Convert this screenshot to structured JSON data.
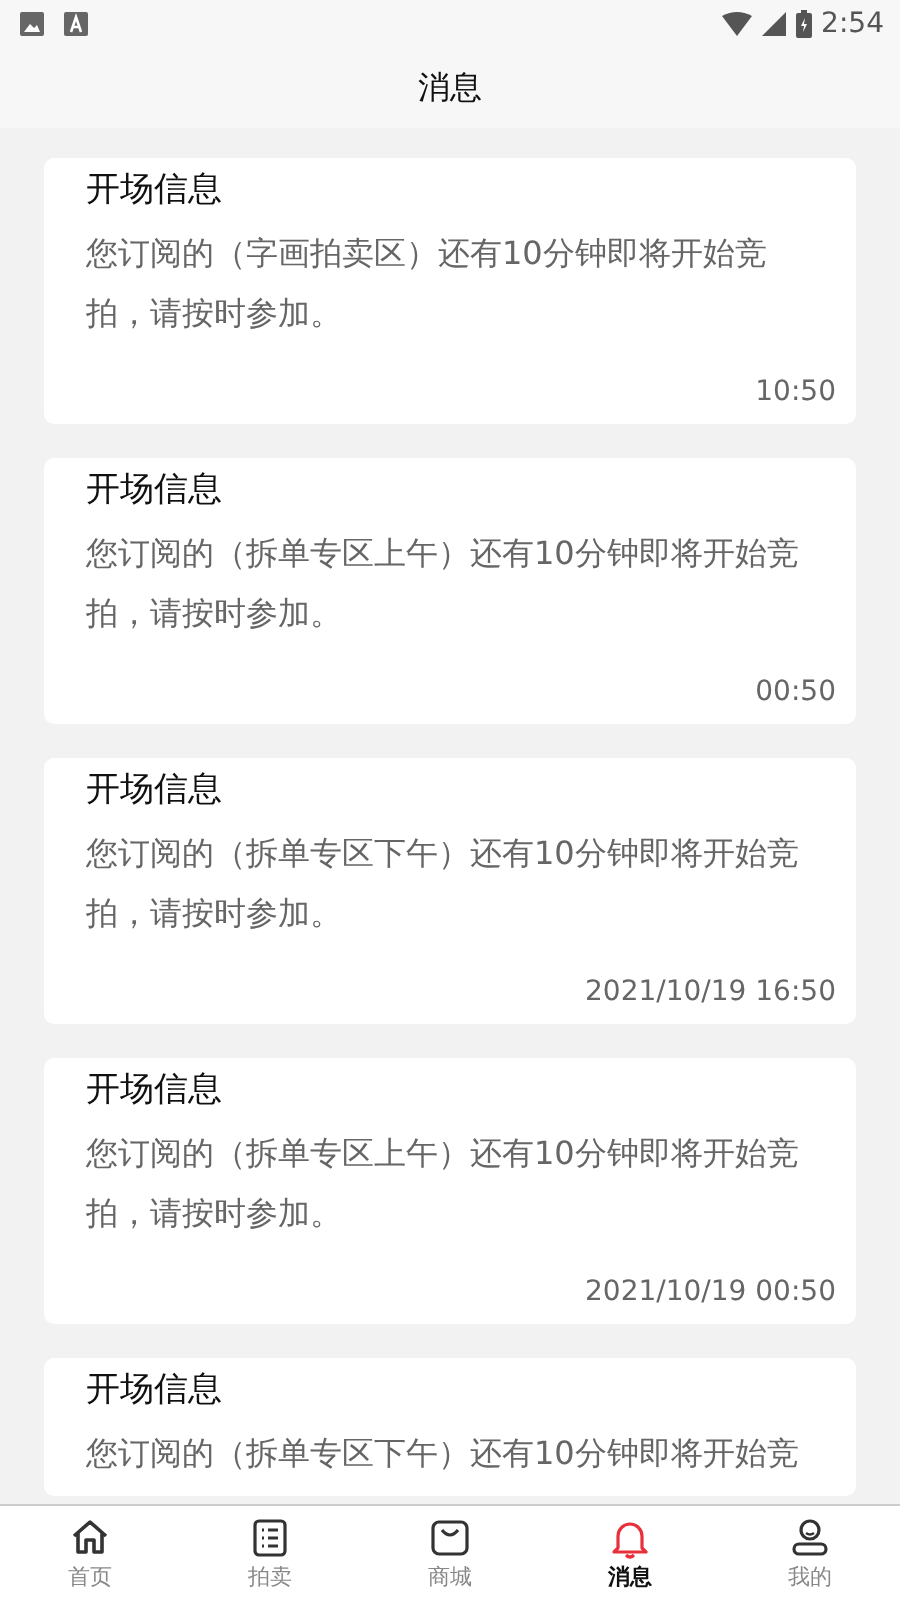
{
  "status_bar": {
    "time": "2:54"
  },
  "header": {
    "title": "消息"
  },
  "messages": [
    {
      "title": "开场信息",
      "body": "您订阅的（字画拍卖区）还有10分钟即将开始竞拍，请按时参加。",
      "time": "10:50"
    },
    {
      "title": "开场信息",
      "body": "您订阅的（拆单专区上午）还有10分钟即将开始竞拍，请按时参加。",
      "time": "00:50"
    },
    {
      "title": "开场信息",
      "body": "您订阅的（拆单专区下午）还有10分钟即将开始竞拍，请按时参加。",
      "time": "2021/10/19 16:50"
    },
    {
      "title": "开场信息",
      "body": "您订阅的（拆单专区上午）还有10分钟即将开始竞拍，请按时参加。",
      "time": "2021/10/19 00:50"
    },
    {
      "title": "开场信息",
      "body": "您订阅的（拆单专区下午）还有10分钟即将开始竞"
    }
  ],
  "tab_bar": [
    {
      "kind": "home",
      "label": "首页",
      "selected": false
    },
    {
      "kind": "list",
      "label": "拍卖",
      "selected": false
    },
    {
      "kind": "bag",
      "label": "商城",
      "selected": false
    },
    {
      "kind": "bell",
      "label": "消息",
      "selected": true
    },
    {
      "kind": "user",
      "label": "我的",
      "selected": false
    }
  ]
}
